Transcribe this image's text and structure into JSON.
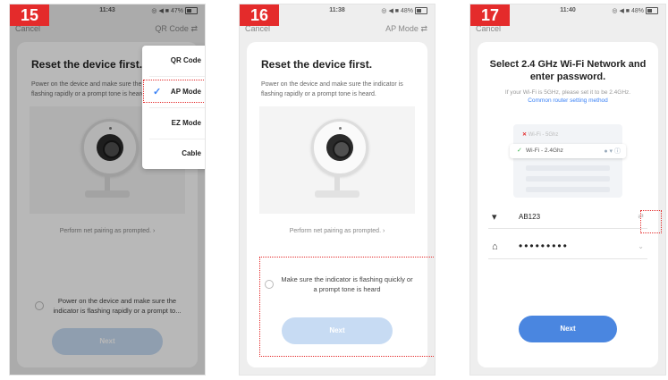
{
  "screens": [
    {
      "step": "15",
      "status": {
        "time": "11:43",
        "right": "◎ ◀ ■ 47%"
      },
      "nav": {
        "cancel": "Cancel",
        "mode": "QR Code"
      },
      "title": "Reset the device first.",
      "description": "Power on the device and make sure the indicator is flashing rapidly or a prompt tone is heard.",
      "link": "Perform net pairing as prompted. ›",
      "check_text": "Power on the device and make sure the indicator is flashing rapidly or a prompt to...",
      "next_label": "Next",
      "dropdown": {
        "items": [
          "QR Code",
          "AP Mode",
          "EZ Mode",
          "Cable"
        ],
        "selected": "AP Mode"
      }
    },
    {
      "step": "16",
      "status": {
        "time": "11:38",
        "right": "◎ ◀ ■ 48%"
      },
      "nav": {
        "cancel": "Cancel",
        "mode": "AP Mode"
      },
      "title": "Reset the device first.",
      "description": "Power on the device and make sure the indicator is flashing rapidly or a prompt tone is heard.",
      "link": "Perform net pairing as prompted. ›",
      "check_text": "Make sure the indicator is flashing quickly or a prompt tone is heard",
      "next_label": "Next"
    },
    {
      "step": "17",
      "status": {
        "time": "11:40",
        "right": "◎ ◀ ■ 48%"
      },
      "nav": {
        "cancel": "Cancel"
      },
      "title": "Select 2.4 GHz Wi-Fi Network and enter password.",
      "note": "If your Wi-Fi is 5GHz, please set it to be 2.4GHz.",
      "note_link": "Common router setting method",
      "wifi_5g": "Wi-Fi - 5Ghz",
      "wifi_24": "Wi-Fi - 2.4Ghz",
      "ssid": "AB123",
      "password": "•••••••••",
      "next_label": "Next"
    }
  ],
  "colors": {
    "badge": "#e42b2b",
    "accent": "#4a86e0",
    "next_disabled": "#c7dbf3"
  }
}
